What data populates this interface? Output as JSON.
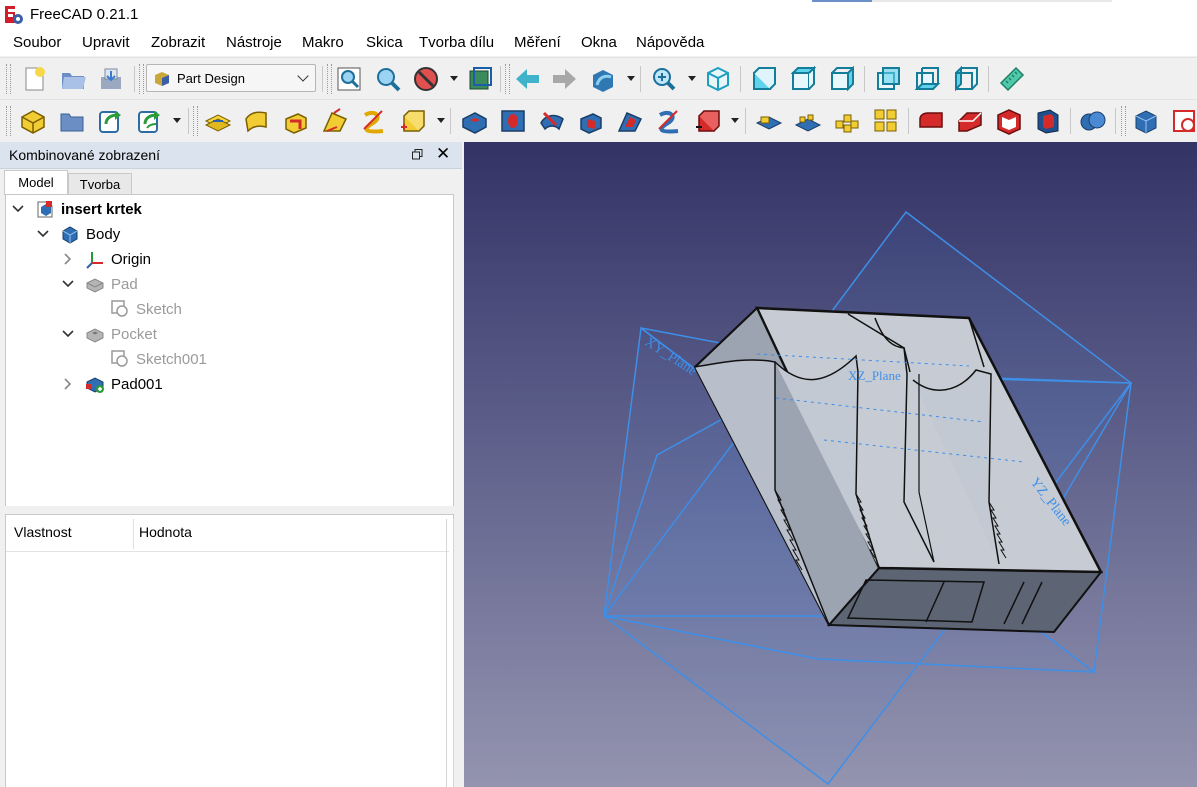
{
  "window": {
    "title": "FreeCAD 0.21.1"
  },
  "menu": [
    "Soubor",
    "Upravit",
    "Zobrazit",
    "Nástroje",
    "Makro",
    "Skica",
    "Tvorba dílu",
    "Měření",
    "Okna",
    "Nápověda"
  ],
  "toolbar": {
    "workbench": "Part Design"
  },
  "combo_view": {
    "title": "Kombinované zobrazení",
    "tabs": [
      "Model",
      "Tvorba"
    ],
    "active_tab": "Model",
    "tree": [
      {
        "label": "insert krtek",
        "level": 0,
        "expanded": true,
        "icon": "document-icon",
        "bold": true
      },
      {
        "label": "Body",
        "level": 1,
        "expanded": true,
        "icon": "body-icon"
      },
      {
        "label": "Origin",
        "level": 2,
        "expanded": false,
        "icon": "origin-axes-icon"
      },
      {
        "label": "Pad",
        "level": 2,
        "expanded": true,
        "icon": "pad-icon",
        "hidden": true
      },
      {
        "label": "Sketch",
        "level": 3,
        "icon": "sketch-icon",
        "hidden": true
      },
      {
        "label": "Pocket",
        "level": 2,
        "expanded": true,
        "icon": "pocket-icon",
        "hidden": true
      },
      {
        "label": "Sketch001",
        "level": 3,
        "icon": "sketch-icon",
        "hidden": true
      },
      {
        "label": "Pad001",
        "level": 2,
        "expanded": false,
        "icon": "pad-tip-icon"
      }
    ],
    "property_columns": [
      "Vlastnost",
      "Hodnota"
    ]
  },
  "viewport": {
    "plane_labels": [
      "XY_Plane",
      "XZ_Plane",
      "YZ_Plane"
    ],
    "background_top": "#333366",
    "background_bottom": "#9494b0",
    "plane_color": "#3d8fe8"
  }
}
